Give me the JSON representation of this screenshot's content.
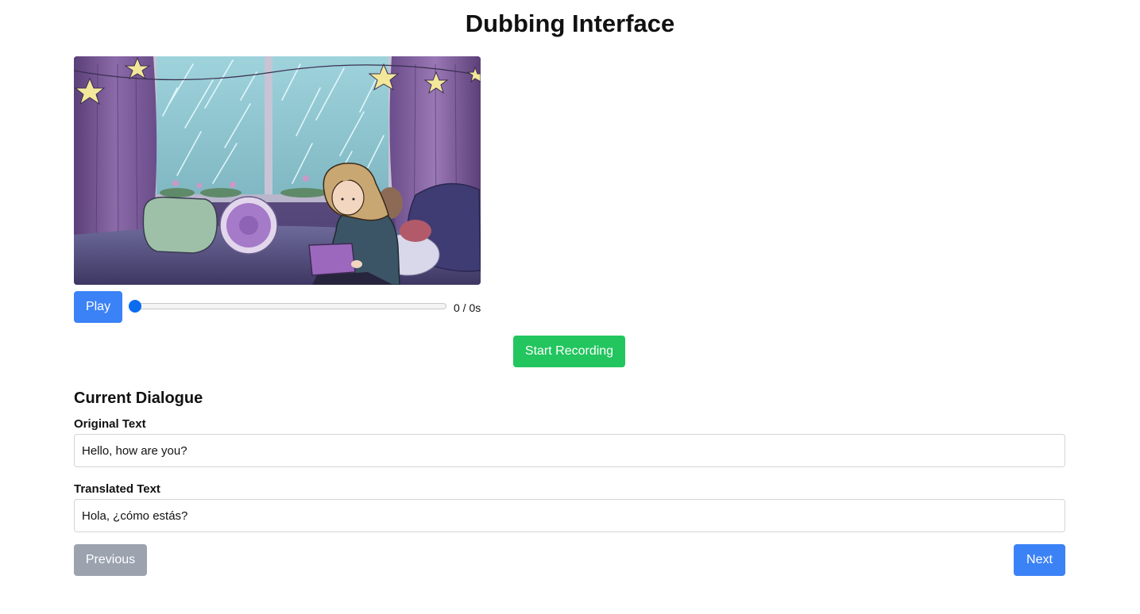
{
  "page": {
    "title": "Dubbing Interface"
  },
  "player": {
    "play_label": "Play",
    "time_readout": "0 / 0s",
    "progress_fraction": 0,
    "thumbnail": "animated-scene-girl-with-laptop-by-rainy-window"
  },
  "recording": {
    "start_label": "Start Recording"
  },
  "dialogue": {
    "heading": "Current Dialogue",
    "original_label": "Original Text",
    "original_value": "Hello, how are you?",
    "translated_label": "Translated Text",
    "translated_value": "Hola, ¿cómo estás?"
  },
  "navigation": {
    "previous_label": "Previous",
    "next_label": "Next"
  },
  "colors": {
    "primary": "#3b82f6",
    "record": "#22c55e",
    "disabled": "#9ca3af",
    "slider_thumb": "#0b6cf0"
  }
}
